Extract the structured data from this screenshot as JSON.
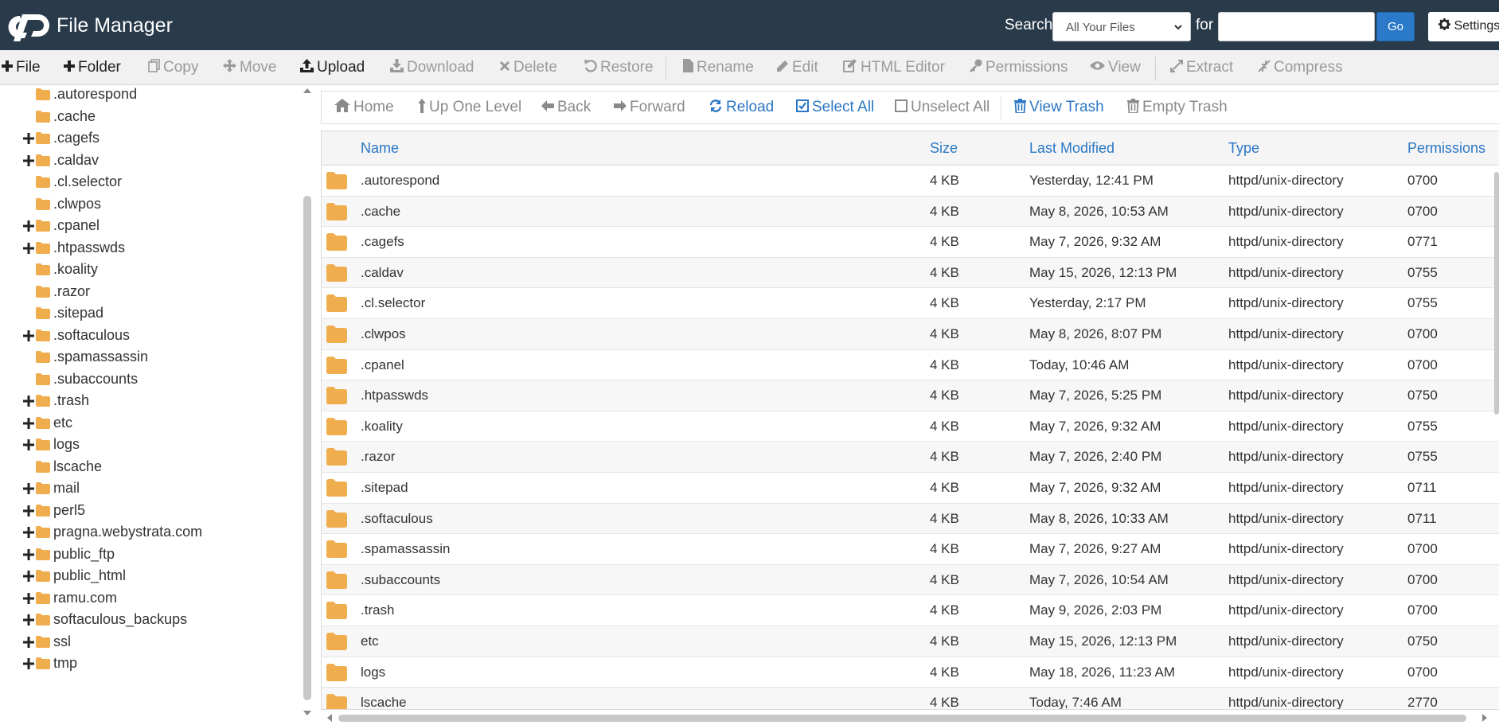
{
  "header": {
    "app_title": "File Manager",
    "search_label": "Search",
    "search_scope": "All Your Files",
    "for_label": "for",
    "search_value": "",
    "go_label": "Go",
    "settings_label": "Settings",
    "bg_color": "#293a4a"
  },
  "toolbar": {
    "file": "File",
    "folder": "Folder",
    "copy": "Copy",
    "move": "Move",
    "upload": "Upload",
    "download": "Download",
    "delete": "Delete",
    "restore": "Restore",
    "rename": "Rename",
    "edit": "Edit",
    "html_editor": "HTML Editor",
    "permissions": "Permissions",
    "view": "View",
    "extract": "Extract",
    "compress": "Compress"
  },
  "sidebar": {
    "items": [
      {
        "label": ".autorespond",
        "expandable": false
      },
      {
        "label": ".cache",
        "expandable": false
      },
      {
        "label": ".cagefs",
        "expandable": true
      },
      {
        "label": ".caldav",
        "expandable": true
      },
      {
        "label": ".cl.selector",
        "expandable": false
      },
      {
        "label": ".clwpos",
        "expandable": false
      },
      {
        "label": ".cpanel",
        "expandable": true
      },
      {
        "label": ".htpasswds",
        "expandable": true
      },
      {
        "label": ".koality",
        "expandable": false
      },
      {
        "label": ".razor",
        "expandable": false
      },
      {
        "label": ".sitepad",
        "expandable": false
      },
      {
        "label": ".softaculous",
        "expandable": true
      },
      {
        "label": ".spamassassin",
        "expandable": false
      },
      {
        "label": ".subaccounts",
        "expandable": false
      },
      {
        "label": ".trash",
        "expandable": true
      },
      {
        "label": "etc",
        "expandable": true
      },
      {
        "label": "logs",
        "expandable": true
      },
      {
        "label": "lscache",
        "expandable": false
      },
      {
        "label": "mail",
        "expandable": true
      },
      {
        "label": "perl5",
        "expandable": true
      },
      {
        "label": "pragna.webystrata.com",
        "expandable": true
      },
      {
        "label": "public_ftp",
        "expandable": true
      },
      {
        "label": "public_html",
        "expandable": true
      },
      {
        "label": "ramu.com",
        "expandable": true
      },
      {
        "label": "softaculous_backups",
        "expandable": true
      },
      {
        "label": "ssl",
        "expandable": true
      },
      {
        "label": "tmp",
        "expandable": true
      }
    ]
  },
  "nav": {
    "home": "Home",
    "up_one_level": "Up One Level",
    "back": "Back",
    "forward": "Forward",
    "reload": "Reload",
    "select_all": "Select All",
    "unselect_all": "Unselect All",
    "view_trash": "View Trash",
    "empty_trash": "Empty Trash"
  },
  "table": {
    "columns": {
      "name": "Name",
      "size": "Size",
      "last_modified": "Last Modified",
      "type": "Type",
      "permissions": "Permissions"
    },
    "rows": [
      {
        "name": ".autorespond",
        "size": "4 KB",
        "modified": "Yesterday, 12:41 PM",
        "type": "httpd/unix-directory",
        "perms": "0700"
      },
      {
        "name": ".cache",
        "size": "4 KB",
        "modified": "May 8, 2026, 10:53 AM",
        "type": "httpd/unix-directory",
        "perms": "0700"
      },
      {
        "name": ".cagefs",
        "size": "4 KB",
        "modified": "May 7, 2026, 9:32 AM",
        "type": "httpd/unix-directory",
        "perms": "0771"
      },
      {
        "name": ".caldav",
        "size": "4 KB",
        "modified": "May 15, 2026, 12:13 PM",
        "type": "httpd/unix-directory",
        "perms": "0755"
      },
      {
        "name": ".cl.selector",
        "size": "4 KB",
        "modified": "Yesterday, 2:17 PM",
        "type": "httpd/unix-directory",
        "perms": "0755"
      },
      {
        "name": ".clwpos",
        "size": "4 KB",
        "modified": "May 8, 2026, 8:07 PM",
        "type": "httpd/unix-directory",
        "perms": "0700"
      },
      {
        "name": ".cpanel",
        "size": "4 KB",
        "modified": "Today, 10:46 AM",
        "type": "httpd/unix-directory",
        "perms": "0700"
      },
      {
        "name": ".htpasswds",
        "size": "4 KB",
        "modified": "May 7, 2026, 5:25 PM",
        "type": "httpd/unix-directory",
        "perms": "0750"
      },
      {
        "name": ".koality",
        "size": "4 KB",
        "modified": "May 7, 2026, 9:32 AM",
        "type": "httpd/unix-directory",
        "perms": "0755"
      },
      {
        "name": ".razor",
        "size": "4 KB",
        "modified": "May 7, 2026, 2:40 PM",
        "type": "httpd/unix-directory",
        "perms": "0755"
      },
      {
        "name": ".sitepad",
        "size": "4 KB",
        "modified": "May 7, 2026, 9:32 AM",
        "type": "httpd/unix-directory",
        "perms": "0711"
      },
      {
        "name": ".softaculous",
        "size": "4 KB",
        "modified": "May 8, 2026, 10:33 AM",
        "type": "httpd/unix-directory",
        "perms": "0711"
      },
      {
        "name": ".spamassassin",
        "size": "4 KB",
        "modified": "May 7, 2026, 9:27 AM",
        "type": "httpd/unix-directory",
        "perms": "0700"
      },
      {
        "name": ".subaccounts",
        "size": "4 KB",
        "modified": "May 7, 2026, 10:54 AM",
        "type": "httpd/unix-directory",
        "perms": "0700"
      },
      {
        "name": ".trash",
        "size": "4 KB",
        "modified": "May 9, 2026, 2:03 PM",
        "type": "httpd/unix-directory",
        "perms": "0700"
      },
      {
        "name": "etc",
        "size": "4 KB",
        "modified": "May 15, 2026, 12:13 PM",
        "type": "httpd/unix-directory",
        "perms": "0750"
      },
      {
        "name": "logs",
        "size": "4 KB",
        "modified": "May 18, 2026, 11:23 AM",
        "type": "httpd/unix-directory",
        "perms": "0700"
      },
      {
        "name": "lscache",
        "size": "4 KB",
        "modified": "Today, 7:46 AM",
        "type": "httpd/unix-directory",
        "perms": "2770"
      }
    ]
  },
  "colors": {
    "folder": "#f0ad4e",
    "link_blue": "#2b77c4",
    "go_button": "#2a7ac9"
  },
  "icons": {
    "logo": "cpanel-logo-icon",
    "folder": "folder-icon",
    "expand": "plus-icon"
  }
}
